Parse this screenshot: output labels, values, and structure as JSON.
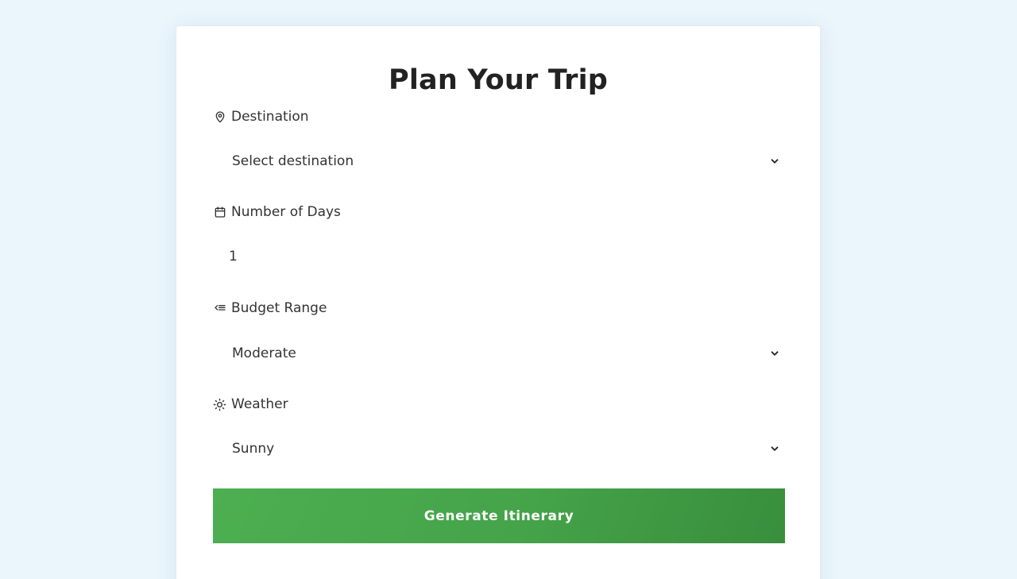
{
  "form": {
    "title": "Plan Your Trip",
    "destination": {
      "label": "Destination",
      "value": "Select destination",
      "icon": "map-pin-icon"
    },
    "days": {
      "label": "Number of Days",
      "value": "1",
      "icon": "calendar-icon"
    },
    "budget": {
      "label": "Budget Range",
      "value": "Moderate",
      "icon": "coins-icon"
    },
    "weather": {
      "label": "Weather",
      "value": "Sunny",
      "icon": "sun-icon"
    },
    "submit_label": "Generate Itinerary"
  },
  "colors": {
    "page_background": "#eaf5fc",
    "card_background": "#ffffff",
    "button_start": "#4caf50",
    "button_end": "#388e3c",
    "text": "#333333"
  }
}
